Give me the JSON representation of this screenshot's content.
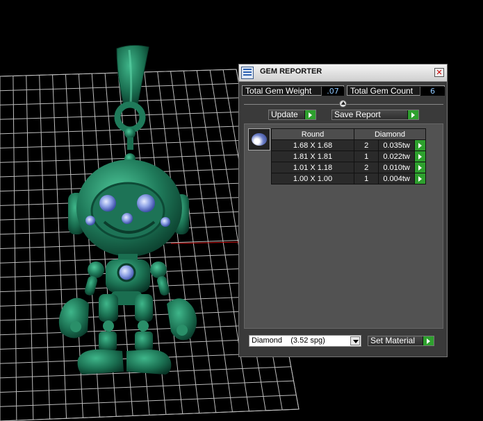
{
  "panel": {
    "title": "GEM REPORTER",
    "close_glyph": "✕",
    "total_gem_weight_label": "Total Gem Weight",
    "total_gem_weight_value": ".07",
    "total_gem_count_label": "Total Gem Count",
    "total_gem_count_value": "6",
    "update_label": "Update",
    "save_report_label": "Save Report",
    "table": {
      "headers": [
        "Round",
        "Diamond"
      ],
      "rows": [
        {
          "size": "1.68 X 1.68",
          "count": "2",
          "weight": "0.035tw"
        },
        {
          "size": "1.81 X 1.81",
          "count": "1",
          "weight": "0.022tw"
        },
        {
          "size": "1.01 X 1.18",
          "count": "2",
          "weight": "0.010tw"
        },
        {
          "size": "1.00 X 1.00",
          "count": "1",
          "weight": "0.004tw"
        }
      ]
    },
    "material_select": "Diamond    (3.52 spg)",
    "set_material_label": "Set Material"
  },
  "icons": [
    "gem-reporter-app-icon",
    "close-icon",
    "slider-knob-icon",
    "play-arrow-icon",
    "round-gem-icon",
    "dropdown-arrow-icon"
  ],
  "colors": {
    "model_green": "#1f7a5a",
    "play_green": "#2ea02e",
    "value_blue": "#8fc8ff",
    "panel_bg": "#3a3a3a",
    "grid_line": "#bfbfbf",
    "axis_red": "#d01010"
  }
}
